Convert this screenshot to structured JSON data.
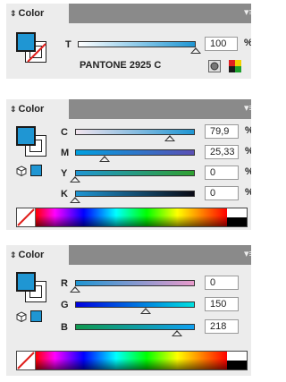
{
  "panels": [
    {
      "tab_label": "Color",
      "mode": "tint",
      "rows": [
        {
          "label": "T",
          "value": "100",
          "unit": "%",
          "thumb": 1.0
        }
      ],
      "swatch_name": "PANTONE 2925 C"
    },
    {
      "tab_label": "Color",
      "mode": "cmyk",
      "rows": [
        {
          "label": "C",
          "value": "79,9",
          "unit": "%",
          "thumb": 0.799
        },
        {
          "label": "M",
          "value": "25,33",
          "unit": "%",
          "thumb": 0.2533
        },
        {
          "label": "Y",
          "value": "0",
          "unit": "%",
          "thumb": 0.0
        },
        {
          "label": "K",
          "value": "0",
          "unit": "%",
          "thumb": 0.0
        }
      ]
    },
    {
      "tab_label": "Color",
      "mode": "rgb",
      "rows": [
        {
          "label": "R",
          "value": "0",
          "unit": "",
          "thumb": 0.0
        },
        {
          "label": "G",
          "value": "150",
          "unit": "",
          "thumb": 0.588
        },
        {
          "label": "B",
          "value": "218",
          "unit": "",
          "thumb": 0.855
        }
      ]
    }
  ],
  "colors": {
    "fill": "#1f96d3",
    "tabbar": "#8a8a8a",
    "panel_bg": "#ececec"
  },
  "icons": {
    "collapse_arrow": "⇕",
    "panel_menu": "panel-menu-icon",
    "out_of_gamut": "cube-icon",
    "none_swatch": "none-swatch-icon"
  }
}
